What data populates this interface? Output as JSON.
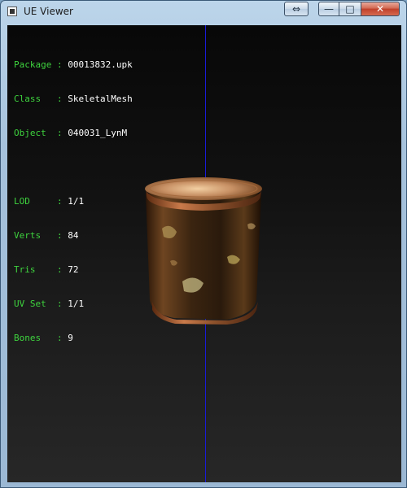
{
  "window": {
    "title": "UE Viewer",
    "buttons": {
      "swap": "⇔",
      "minimize": "—",
      "maximize": "□",
      "close": "✕"
    }
  },
  "viewer": {
    "info_top": [
      {
        "key": "Package",
        "sep": ":",
        "value": "00013832.upk"
      },
      {
        "key": "Class  ",
        "sep": ":",
        "value": "SkeletalMesh"
      },
      {
        "key": "Object ",
        "sep": ":",
        "value": "040031_LynM"
      }
    ],
    "info_stats": [
      {
        "key": "LOD    ",
        "sep": ":",
        "value": "1/1"
      },
      {
        "key": "Verts  ",
        "sep": ":",
        "value": "84"
      },
      {
        "key": "Tris   ",
        "sep": ":",
        "value": "72"
      },
      {
        "key": "UV Set ",
        "sep": ":",
        "value": "1/1"
      },
      {
        "key": "Bones  ",
        "sep": ":",
        "value": "9"
      }
    ]
  },
  "colors": {
    "label": "#3ed33e",
    "value": "#ffffff",
    "axis": "#1a1ad8",
    "background_top": "#080808",
    "background_bottom": "#272727"
  }
}
